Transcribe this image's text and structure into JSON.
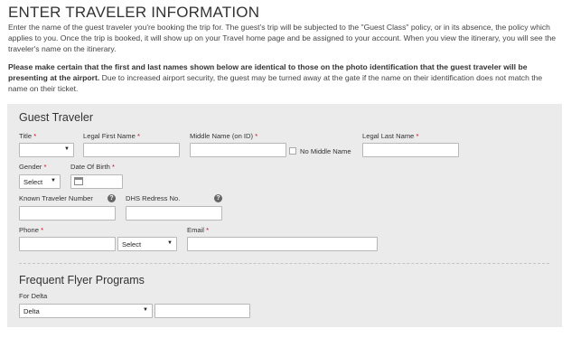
{
  "page": {
    "title": "ENTER TRAVELER INFORMATION",
    "intro": "Enter the name of the guest traveler you're booking the trip for. The guest's trip will be subjected to the \"Guest Class\" policy, or in its absence, the policy which applies to you. Once the trip is booked, it will show up on your Travel home page and be assigned to your account. When you view the itinerary, you will see the traveler's name on the itinerary.",
    "warning_bold": "Please make certain that the first and last names shown below are identical to those on the photo identification that the guest traveler will be presenting at the airport.",
    "warning_rest": " Due to increased airport security, the guest may be turned away at the gate if the name on their identification does not match the name on their ticket."
  },
  "guest_traveler": {
    "section_title": "Guest Traveler",
    "title_label": "Title",
    "first_name_label": "Legal First Name",
    "middle_name_label": "Middle Name (on ID)",
    "no_middle_name_label": "No Middle Name",
    "last_name_label": "Legal Last Name",
    "gender_label": "Gender",
    "gender_value": "Select",
    "dob_label": "Date Of Birth",
    "ktn_label": "Known Traveler Number",
    "dhs_label": "DHS Redress No.",
    "phone_label": "Phone",
    "phone_type_value": "Select",
    "email_label": "Email",
    "required_mark": "*"
  },
  "frequent_flyer": {
    "section_title": "Frequent Flyer Programs",
    "for_label": "For Delta",
    "airline_value": "Delta"
  },
  "icons": {
    "help": "?",
    "dropdown": "▼"
  },
  "colors": {
    "required": "#d0021b",
    "panel_bg": "#ebebeb"
  }
}
